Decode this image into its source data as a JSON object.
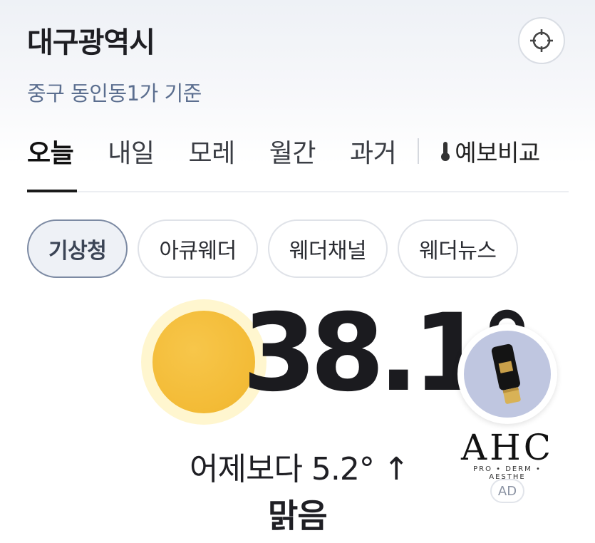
{
  "location": {
    "city": "대구광역시",
    "basis": "중구 동인동1가 기준"
  },
  "tabs": [
    {
      "label": "오늘",
      "active": true
    },
    {
      "label": "내일",
      "active": false
    },
    {
      "label": "모레",
      "active": false
    },
    {
      "label": "월간",
      "active": false
    },
    {
      "label": "과거",
      "active": false
    }
  ],
  "compare_label": "예보비교",
  "sources": [
    {
      "label": "기상청",
      "active": true
    },
    {
      "label": "아큐웨더",
      "active": false
    },
    {
      "label": "웨더채널",
      "active": false
    },
    {
      "label": "웨더뉴스",
      "active": false
    }
  ],
  "weather": {
    "temperature": "38.1°",
    "diff_prefix": "어제보다",
    "diff_value": "5.2°",
    "diff_arrow": "↑",
    "condition": "맑음",
    "icon": "sun-icon"
  },
  "ad": {
    "brand": "AHC",
    "tagline": "PRO • DERM • AESTHE",
    "badge": "AD"
  },
  "colors": {
    "sun": "#f3bb36",
    "accent_text": "#5b6e8f",
    "active_chip_border": "#7c8aa3"
  }
}
